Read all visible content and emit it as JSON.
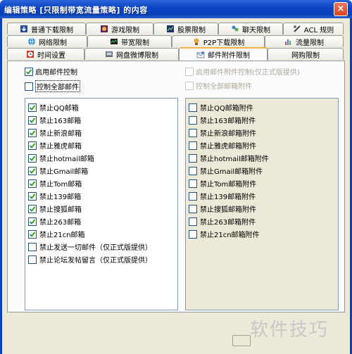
{
  "window": {
    "title": "编辑策略 [只限制带宽流量策略] 的内容",
    "close_label": "×"
  },
  "tabs": {
    "row1": [
      {
        "label": "普通下载限制",
        "icon": "download-icon"
      },
      {
        "label": "游戏限制",
        "icon": "game-icon"
      },
      {
        "label": "股票限制",
        "icon": "stock-icon"
      },
      {
        "label": "聊天限制",
        "icon": "chat-icon"
      },
      {
        "label": "ACL 规则",
        "icon": "acl-icon"
      }
    ],
    "row2": [
      {
        "label": "网络限制",
        "icon": "globe-icon"
      },
      {
        "label": "带宽限制",
        "icon": "bandwidth-icon"
      },
      {
        "label": "P2P下载限制",
        "icon": "p2p-icon"
      },
      {
        "label": "流量限制",
        "icon": "traffic-chart-icon"
      }
    ],
    "row3": [
      {
        "label": "时间设置",
        "icon": "clock-icon"
      },
      {
        "label": "网盘微博限制",
        "icon": "cloud-disk-icon"
      },
      {
        "label": "邮件附件限制",
        "icon": "mail-attachment-icon",
        "active": true
      },
      {
        "label": "网购限制",
        "icon": ""
      }
    ]
  },
  "mail_control": {
    "enable_label": "启用邮件控制",
    "enable_checked": true,
    "all_label": "控制全部邮件",
    "all_checked": false,
    "items": [
      {
        "label": "禁止QQ邮箱",
        "checked": true
      },
      {
        "label": "禁止163邮箱",
        "checked": true
      },
      {
        "label": "禁止新浪邮箱",
        "checked": true
      },
      {
        "label": "禁止雅虎邮箱",
        "checked": true
      },
      {
        "label": "禁止hotmail邮箱",
        "checked": true
      },
      {
        "label": "禁止Gmail邮箱",
        "checked": true
      },
      {
        "label": "禁止Tom邮箱",
        "checked": true
      },
      {
        "label": "禁止139邮箱",
        "checked": true
      },
      {
        "label": "禁止搜狐邮箱",
        "checked": true
      },
      {
        "label": "禁止263邮箱",
        "checked": true
      },
      {
        "label": "禁止21cn邮箱",
        "checked": true
      },
      {
        "label": "禁止发送一切邮件（仅正式版提供）",
        "checked": false
      },
      {
        "label": "禁止论坛发帖留言（仅正式版提供）",
        "checked": false
      }
    ]
  },
  "attachment_control": {
    "enable_label": "启用邮件附件控制(仅正式版提供)",
    "all_label": "控制全部邮箱附件",
    "items": [
      {
        "label": "禁止QQ邮箱附件"
      },
      {
        "label": "禁止163邮箱附件"
      },
      {
        "label": "禁止新浪邮箱附件"
      },
      {
        "label": "禁止雅虎邮箱附件"
      },
      {
        "label": "禁止hotmail邮箱附件"
      },
      {
        "label": "禁止Gmail邮箱附件"
      },
      {
        "label": "禁止Tom邮箱附件"
      },
      {
        "label": "禁止139邮箱附件"
      },
      {
        "label": "禁止搜狐邮箱附件"
      },
      {
        "label": "禁止263邮箱附件"
      },
      {
        "label": "禁止21cn邮箱附件"
      }
    ]
  },
  "watermark": "软件技巧",
  "colors": {
    "titlebar": "#0a44c4",
    "dialog_bg": "#ece9d8",
    "active_tab_accent": "#f1b53c"
  }
}
